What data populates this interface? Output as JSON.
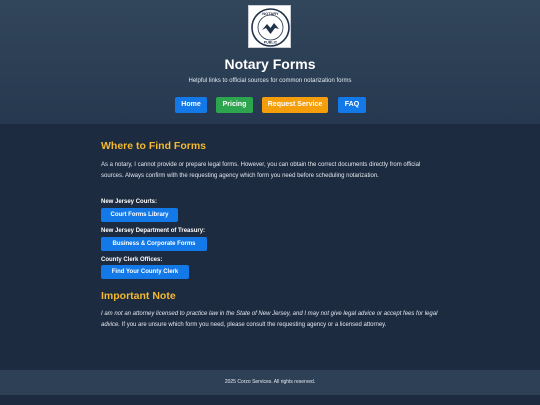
{
  "header": {
    "title": "Notary Forms",
    "subtitle": "Helpful links to official sources for common notarization forms",
    "logo_text": "NOTARY PUBLIC"
  },
  "nav": [
    {
      "label": "Home",
      "color": "#1379e8"
    },
    {
      "label": "Pricing",
      "color": "#2da44e"
    },
    {
      "label": "Request Service",
      "color": "#f59e0b"
    },
    {
      "label": "FAQ",
      "color": "#1379e8"
    }
  ],
  "main": {
    "where_heading": "Where to Find Forms",
    "where_text": "As a notary, I cannot provide or prepare legal forms. However, you can obtain the correct documents directly from official sources. Always confirm with the requesting agency which form you need before scheduling notarization.",
    "sources": [
      {
        "label": "New Jersey Courts:",
        "button": "Court Forms Library"
      },
      {
        "label": "New Jersey Department of Treasury:",
        "button": "Business & Corporate Forms"
      },
      {
        "label": "County Clerk Offices:",
        "button": "Find Your County Clerk"
      }
    ],
    "note_heading": "Important Note",
    "note_italic": "I am not an attorney licensed to practice law in the State of New Jersey, and I may not give legal advice or accept fees for legal advice.",
    "note_rest": "If you are unsure which form you need, please consult the requesting agency or a licensed attorney."
  },
  "footer": {
    "text": "2025 Corzo Services. All rights reserved."
  }
}
